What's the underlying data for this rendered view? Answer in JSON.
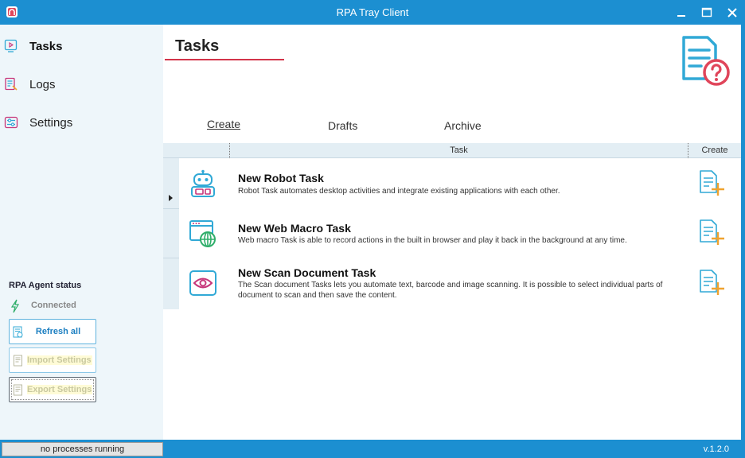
{
  "window": {
    "title": "RPA Tray Client"
  },
  "sidebar": {
    "items": [
      {
        "label": "Tasks",
        "icon": "tasks-icon",
        "active": true
      },
      {
        "label": "Logs",
        "icon": "logs-icon",
        "active": false
      },
      {
        "label": "Settings",
        "icon": "settings-icon",
        "active": false
      }
    ],
    "agent": {
      "title": "RPA Agent status",
      "status": "Connected"
    },
    "buttons": {
      "refresh": "Refresh all",
      "import": "Import Settings",
      "export": "Export Settings"
    }
  },
  "main": {
    "title": "Tasks",
    "tabs": [
      {
        "label": "Create",
        "active": true
      },
      {
        "label": "Drafts",
        "active": false
      },
      {
        "label": "Archive",
        "active": false
      }
    ],
    "grid": {
      "columns": {
        "task": "Task",
        "create": "Create"
      },
      "rows": [
        {
          "name": "New Robot Task",
          "description": "Robot Task automates desktop activities and integrate existing applications with each other.",
          "icon": "robot-icon"
        },
        {
          "name": "New Web Macro Task",
          "description": "Web macro Task is able to record actions in the built in browser and play it back in the background at any time.",
          "icon": "web-globe-icon"
        },
        {
          "name": "New Scan Document Task",
          "description": "The Scan document Tasks lets you automate text, barcode and image scanning. It is possible to select individual parts of document to scan and then save the content.",
          "icon": "eye-scan-icon"
        }
      ]
    }
  },
  "statusbar": {
    "processes": "no processes running",
    "version": "v.1.2.0"
  },
  "colors": {
    "accent": "#1c8fd1",
    "underline": "#d3344a",
    "sidebar_bg": "#eef6fa",
    "icon_teal": "#31a9d6",
    "icon_pink": "#c7367a",
    "icon_orange": "#f0a32f"
  }
}
